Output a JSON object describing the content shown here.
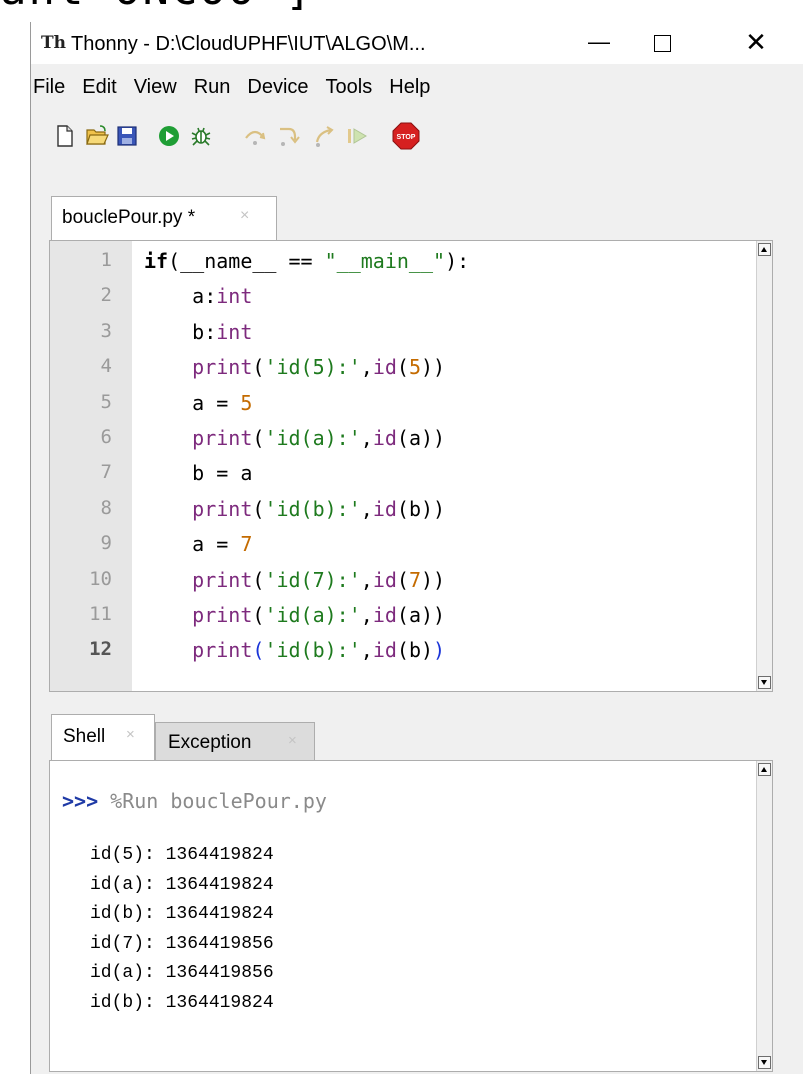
{
  "cropped_heading": "ant ONCOO ]",
  "window": {
    "title": "Thonny - D:\\CloudUPHF\\IUT\\ALGO\\M...",
    "app_icon_glyph": "Th",
    "minimize": "—",
    "close": "✕"
  },
  "menu": [
    "File",
    "Edit",
    "View",
    "Run",
    "Device",
    "Tools",
    "Help"
  ],
  "toolbar": [
    {
      "name": "new-file-icon"
    },
    {
      "name": "open-file-icon"
    },
    {
      "name": "save-icon"
    },
    {
      "name": "run-icon"
    },
    {
      "name": "debug-icon"
    },
    {
      "name": "step-over-icon"
    },
    {
      "name": "step-into-icon"
    },
    {
      "name": "step-out-icon"
    },
    {
      "name": "resume-icon"
    },
    {
      "name": "stop-icon",
      "label": "STOP"
    }
  ],
  "editor": {
    "tab_label": "bouclePour.py *",
    "tab_close": "×",
    "line_numbers": [
      "1",
      "2",
      "3",
      "4",
      "5",
      "6",
      "7",
      "8",
      "9",
      "10",
      "11",
      "12"
    ],
    "current_line": 12,
    "lines": [
      [
        {
          "t": "if",
          "c": "kw"
        },
        {
          "t": "(__name__ == ",
          "c": ""
        },
        {
          "t": "\"__main__\"",
          "c": "str"
        },
        {
          "t": "):",
          "c": ""
        }
      ],
      [
        {
          "t": "    a:",
          "c": ""
        },
        {
          "t": "int",
          "c": "fn"
        }
      ],
      [
        {
          "t": "    b:",
          "c": ""
        },
        {
          "t": "int",
          "c": "fn"
        }
      ],
      [
        {
          "t": "    ",
          "c": ""
        },
        {
          "t": "print",
          "c": "fn"
        },
        {
          "t": "(",
          "c": ""
        },
        {
          "t": "'id(5):'",
          "c": "str"
        },
        {
          "t": ",",
          "c": ""
        },
        {
          "t": "id",
          "c": "fn"
        },
        {
          "t": "(",
          "c": ""
        },
        {
          "t": "5",
          "c": "num"
        },
        {
          "t": "))",
          "c": ""
        }
      ],
      [
        {
          "t": "    a = ",
          "c": ""
        },
        {
          "t": "5",
          "c": "num"
        }
      ],
      [
        {
          "t": "    ",
          "c": ""
        },
        {
          "t": "print",
          "c": "fn"
        },
        {
          "t": "(",
          "c": ""
        },
        {
          "t": "'id(a):'",
          "c": "str"
        },
        {
          "t": ",",
          "c": ""
        },
        {
          "t": "id",
          "c": "fn"
        },
        {
          "t": "(a))",
          "c": ""
        }
      ],
      [
        {
          "t": "    b = a",
          "c": ""
        }
      ],
      [
        {
          "t": "    ",
          "c": ""
        },
        {
          "t": "print",
          "c": "fn"
        },
        {
          "t": "(",
          "c": ""
        },
        {
          "t": "'id(b):'",
          "c": "str"
        },
        {
          "t": ",",
          "c": ""
        },
        {
          "t": "id",
          "c": "fn"
        },
        {
          "t": "(b))",
          "c": ""
        }
      ],
      [
        {
          "t": "    a = ",
          "c": ""
        },
        {
          "t": "7",
          "c": "num"
        }
      ],
      [
        {
          "t": "    ",
          "c": ""
        },
        {
          "t": "print",
          "c": "fn"
        },
        {
          "t": "(",
          "c": ""
        },
        {
          "t": "'id(7):'",
          "c": "str"
        },
        {
          "t": ",",
          "c": ""
        },
        {
          "t": "id",
          "c": "fn"
        },
        {
          "t": "(",
          "c": ""
        },
        {
          "t": "7",
          "c": "num"
        },
        {
          "t": "))",
          "c": ""
        }
      ],
      [
        {
          "t": "    ",
          "c": ""
        },
        {
          "t": "print",
          "c": "fn"
        },
        {
          "t": "(",
          "c": ""
        },
        {
          "t": "'id(a):'",
          "c": "str"
        },
        {
          "t": ",",
          "c": ""
        },
        {
          "t": "id",
          "c": "fn"
        },
        {
          "t": "(a))",
          "c": ""
        }
      ],
      [
        {
          "t": "    ",
          "c": ""
        },
        {
          "t": "print",
          "c": "fn"
        },
        {
          "t": "(",
          "c": "br"
        },
        {
          "t": "'id(b):'",
          "c": "str"
        },
        {
          "t": ",",
          "c": ""
        },
        {
          "t": "id",
          "c": "fn"
        },
        {
          "t": "(b)",
          "c": ""
        },
        {
          "t": ")",
          "c": "br"
        }
      ]
    ]
  },
  "shell": {
    "tab_label": "Shell",
    "tab_close": "×",
    "exception_tab_label": "Exception",
    "prompt": ">>>",
    "command": " %Run bouclePour.py",
    "output": [
      "id(5): 1364419824",
      "id(a): 1364419824",
      "id(b): 1364419824",
      "id(7): 1364419856",
      "id(a): 1364419856",
      "id(b): 1364419824"
    ]
  },
  "colors": {
    "keyword": "#000000",
    "builtin": "#7d2a7d",
    "string": "#1e7a1e",
    "number": "#c46b00",
    "bracket_match": "#1a34d8",
    "prompt": "#1f3aa6"
  }
}
